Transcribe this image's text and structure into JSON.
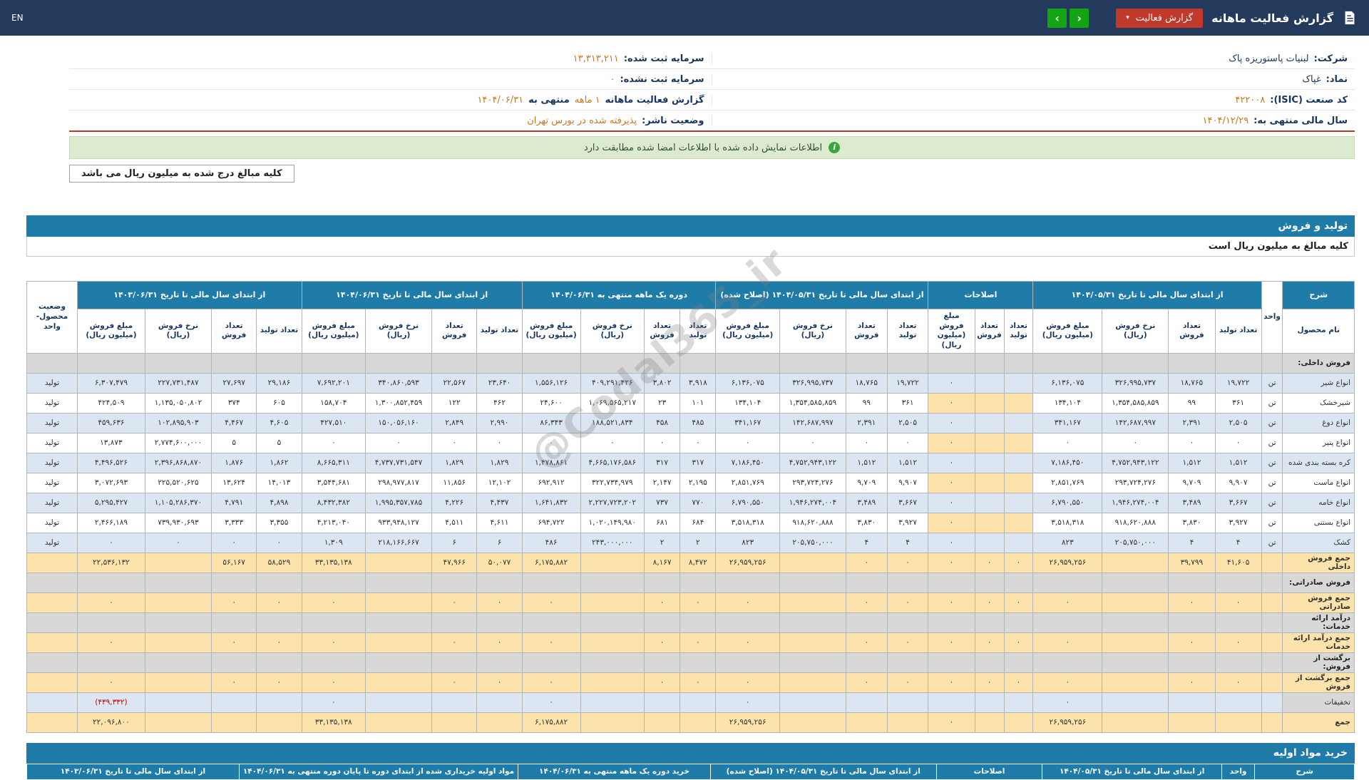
{
  "topbar": {
    "en_label": "EN",
    "title": "گزارش فعالیت ماهانه",
    "report_button_label": "گزارش فعالیت",
    "nav_forward": "›",
    "nav_back": "‹"
  },
  "info": {
    "company_label": "شرکت:",
    "company_value": "لبنیات پاستوریزه پاک",
    "symbol_label": "نماد:",
    "symbol_value": "غپاک",
    "isic_label": "کد صنعت (ISIC):",
    "isic_value": "۴۲۲۰۰۸",
    "fiscal_label": "سال مالی منتهی به:",
    "fiscal_value": "۱۴۰۴/۱۲/۲۹",
    "registered_capital_label": "سرمایه ثبت شده:",
    "registered_capital_value": "۱۳,۳۱۳,۲۱۱",
    "unregistered_capital_label": "سرمایه ثبت نشده:",
    "unregistered_capital_value": "۰",
    "report_period_label": "گزارش فعالیت ماهانه",
    "report_period_value": "۱ ماهه",
    "report_period_suffix": "منتهی به",
    "report_period_date": "۱۴۰۴/۰۶/۳۱",
    "publisher_status_label": "وضعیت ناشر:",
    "publisher_status_value": "پذیرفته شده در بورس تهران"
  },
  "banner": {
    "text": "اطلاعات نمایش داده شده با اطلاعات امضا شده مطابقت دارد",
    "icon": "i"
  },
  "note": {
    "text": "کلیه مبالغ درج شده به میلیون ریال می باشد"
  },
  "production": {
    "bar_title": "تولید و فروش",
    "subtitle": "کلیه مبالغ به میلیون ریال است",
    "table": {
      "headers": {
        "sharh": "شرح",
        "name": "نام محصول",
        "unit": "واحد",
        "status": "وضعیت محصول-واحد"
      },
      "groups": [
        {
          "key": "prior",
          "label": "از ابتدای سال مالی تا تاریخ ۱۴۰۴/۰۵/۳۱",
          "cols": [
            "تعداد تولید",
            "تعداد فروش",
            "نرخ فروش (ریال)",
            "مبلغ فروش (میلیون ریال)"
          ]
        },
        {
          "key": "amend",
          "label": "اصلاحات",
          "cols": [
            "تعداد تولید",
            "تعداد فروش",
            "مبلغ فروش (میلیون ریال)"
          ]
        },
        {
          "key": "amended",
          "label": "از ابتدای سال مالی تا تاریخ ۱۴۰۴/۰۵/۳۱ (اصلاح شده)",
          "cols": [
            "تعداد تولید",
            "تعداد فروش",
            "نرخ فروش (ریال)",
            "مبلغ فروش (میلیون ریال)"
          ]
        },
        {
          "key": "month",
          "label": "دوره یک ماهه منتهی به ۱۴۰۴/۰۶/۳۱",
          "cols": [
            "تعداد تولید",
            "تعداد فروش",
            "نرخ فروش (ریال)",
            "مبلغ فروش (میلیون ریال)"
          ]
        },
        {
          "key": "cur",
          "label": "از ابتدای سال مالی تا تاریخ ۱۴۰۴/۰۶/۳۱",
          "cols": [
            "تعداد تولید",
            "تعداد فروش",
            "نرخ فروش (ریال)",
            "مبلغ فروش (میلیون ریال)"
          ]
        },
        {
          "key": "prev",
          "label": "از ابتدای سال مالی تا تاریخ ۱۴۰۳/۰۶/۳۱",
          "cols": [
            "تعداد تولید",
            "تعداد فروش",
            "نرخ فروش (ریال)",
            "مبلغ فروش (میلیون ریال)"
          ]
        }
      ],
      "rows": [
        {
          "type": "section",
          "name": "فروش داخلی:"
        },
        {
          "type": "data",
          "name": "انواع شیر",
          "unit": "تن",
          "status": "تولید",
          "prior": [
            "۱۹,۷۲۲",
            "۱۸,۷۶۵",
            "۳۲۶,۹۹۵,۷۳۷",
            "۶,۱۳۶,۰۷۵"
          ],
          "amend": [
            "",
            "",
            "۰"
          ],
          "amended": [
            "۱۹,۷۲۲",
            "۱۸,۷۶۵",
            "۳۲۶,۹۹۵,۷۳۷",
            "۶,۱۳۶,۰۷۵"
          ],
          "month": [
            "۳,۹۱۸",
            "۳,۸۰۲",
            "۴۰۹,۲۹۱,۴۲۶",
            "۱,۵۵۶,۱۲۶"
          ],
          "cur": [
            "۲۳,۶۴۰",
            "۲۲,۵۶۷",
            "۳۴۰,۸۶۰,۵۹۳",
            "۷,۶۹۲,۲۰۱"
          ],
          "prev": [
            "۲۹,۱۸۶",
            "۲۷,۶۹۷",
            "۲۲۷,۷۳۱,۴۸۷",
            "۶,۳۰۷,۴۷۹"
          ]
        },
        {
          "type": "data",
          "name": "شیرخشک",
          "unit": "تن",
          "status": "تولید",
          "prior": [
            "۳۶۱",
            "۹۹",
            "۱,۳۵۴,۵۸۵,۸۵۹",
            "۱۳۴,۱۰۴"
          ],
          "amend": [
            "",
            "",
            "۰"
          ],
          "amended": [
            "۳۶۱",
            "۹۹",
            "۱,۳۵۴,۵۸۵,۸۵۹",
            "۱۳۴,۱۰۴"
          ],
          "month": [
            "۱۰۱",
            "۲۳",
            "۱,۰۶۹,۵۶۵,۲۱۷",
            "۲۴,۶۰۰"
          ],
          "cur": [
            "۴۶۲",
            "۱۲۲",
            "۱,۳۰۰,۸۵۲,۴۵۹",
            "۱۵۸,۷۰۴"
          ],
          "prev": [
            "۶۰۵",
            "۳۷۴",
            "۱,۱۳۵,۰۵۰,۸۰۲",
            "۴۲۴,۵۰۹"
          ]
        },
        {
          "type": "data",
          "name": "انواع دوغ",
          "unit": "تن",
          "status": "تولید",
          "prior": [
            "۲,۵۰۵",
            "۲,۳۹۱",
            "۱۴۲,۶۸۷,۹۹۷",
            "۳۴۱,۱۶۷"
          ],
          "amend": [
            "",
            "",
            "۰"
          ],
          "amended": [
            "۲,۵۰۵",
            "۲,۳۹۱",
            "۱۴۲,۶۸۷,۹۹۷",
            "۳۴۱,۱۶۷"
          ],
          "month": [
            "۴۸۵",
            "۴۵۸",
            "۱۸۸,۵۲۱,۸۳۴",
            "۸۶,۳۴۳"
          ],
          "cur": [
            "۲,۹۹۰",
            "۲,۸۴۹",
            "۱۵۰,۰۵۶,۱۶۰",
            "۴۲۷,۵۱۰"
          ],
          "prev": [
            "۴,۶۰۵",
            "۴,۴۶۷",
            "۱۰۲,۸۹۵,۹۰۳",
            "۴۵۹,۶۳۶"
          ]
        },
        {
          "type": "data",
          "name": "انواع پنیر",
          "unit": "تن",
          "status": "تولید",
          "prior": [
            "۰",
            "۰",
            "۰",
            "۰"
          ],
          "amend": [
            "",
            "",
            "۰"
          ],
          "amended": [
            "۰",
            "۰",
            "۰",
            "۰"
          ],
          "month": [
            "۰",
            "۰",
            "۰",
            "۰"
          ],
          "cur": [
            "۰",
            "۰",
            "۰",
            "۰"
          ],
          "prev": [
            "۵",
            "۵",
            "۲,۷۷۴,۶۰۰,۰۰۰",
            "۱۳,۸۷۳"
          ]
        },
        {
          "type": "data",
          "name": "کره بسته بندی شده",
          "unit": "تن",
          "status": "تولید",
          "prior": [
            "۱,۵۱۲",
            "۱,۵۱۲",
            "۴,۷۵۲,۹۴۳,۱۲۲",
            "۷,۱۸۶,۴۵۰"
          ],
          "amend": [
            "",
            "",
            "۰"
          ],
          "amended": [
            "۱,۵۱۲",
            "۱,۵۱۲",
            "۴,۷۵۲,۹۴۳,۱۲۲",
            "۷,۱۸۶,۴۵۰"
          ],
          "month": [
            "۳۱۷",
            "۳۱۷",
            "۴,۶۶۵,۱۷۶,۵۸۶",
            "۱,۴۷۸,۸۶۱"
          ],
          "cur": [
            "۱,۸۲۹",
            "۱,۸۲۹",
            "۴,۷۳۷,۷۳۱,۵۴۷",
            "۸,۶۶۵,۳۱۱"
          ],
          "prev": [
            "۱,۸۶۲",
            "۱,۸۷۶",
            "۲,۳۹۶,۸۶۸,۸۷۰",
            "۴,۴۹۶,۵۲۶"
          ]
        },
        {
          "type": "data",
          "name": "انواع ماست",
          "unit": "تن",
          "status": "تولید",
          "prior": [
            "۹,۹۰۷",
            "۹,۷۰۹",
            "۲۹۳,۷۲۴,۲۷۶",
            "۲,۸۵۱,۷۶۹"
          ],
          "amend": [
            "",
            "",
            "۰"
          ],
          "amended": [
            "۹,۹۰۷",
            "۹,۷۰۹",
            "۲۹۳,۷۲۴,۲۷۶",
            "۲,۸۵۱,۷۶۹"
          ],
          "month": [
            "۲,۱۹۵",
            "۲,۱۴۷",
            "۳۲۲,۷۳۴,۹۷۹",
            "۶۹۲,۹۱۲"
          ],
          "cur": [
            "۱۲,۱۰۲",
            "۱۱,۸۵۶",
            "۲۹۸,۹۷۷,۸۱۷",
            "۳,۵۴۴,۶۸۱"
          ],
          "prev": [
            "۱۴,۰۱۳",
            "۱۳,۶۲۴",
            "۲۲۵,۵۲۰,۶۲۵",
            "۳,۰۷۲,۶۹۳"
          ]
        },
        {
          "type": "data",
          "name": "انواع خامه",
          "unit": "تن",
          "status": "تولید",
          "prior": [
            "۳,۶۶۷",
            "۳,۴۸۹",
            "۱,۹۴۶,۲۷۴,۰۰۴",
            "۶,۷۹۰,۵۵۰"
          ],
          "amend": [
            "",
            "",
            "۰"
          ],
          "amended": [
            "۳,۶۶۷",
            "۳,۴۸۹",
            "۱,۹۴۶,۲۷۴,۰۰۴",
            "۶,۷۹۰,۵۵۰"
          ],
          "month": [
            "۷۷۰",
            "۷۳۷",
            "۲,۲۲۷,۷۲۳,۲۰۲",
            "۱,۶۴۱,۸۳۲"
          ],
          "cur": [
            "۴,۴۳۷",
            "۴,۲۲۶",
            "۱,۹۹۵,۳۵۷,۷۸۵",
            "۸,۴۳۲,۳۸۲"
          ],
          "prev": [
            "۴,۸۹۸",
            "۴,۷۹۱",
            "۱,۱۰۵,۲۸۶,۳۷۰",
            "۵,۲۹۵,۴۲۷"
          ]
        },
        {
          "type": "data",
          "name": "انواع بستنی",
          "unit": "تن",
          "status": "تولید",
          "prior": [
            "۳,۹۲۷",
            "۳,۸۳۰",
            "۹۱۸,۶۲۰,۸۸۸",
            "۳,۵۱۸,۳۱۸"
          ],
          "amend": [
            "",
            "",
            "۰"
          ],
          "amended": [
            "۳,۹۲۷",
            "۳,۸۳۰",
            "۹۱۸,۶۲۰,۸۸۸",
            "۳,۵۱۸,۳۱۸"
          ],
          "month": [
            "۶۸۴",
            "۶۸۱",
            "۱,۰۲۰,۱۴۹,۹۸۰",
            "۶۹۴,۷۲۲"
          ],
          "cur": [
            "۴,۶۱۱",
            "۴,۵۱۱",
            "۹۳۳,۹۴۸,۱۲۷",
            "۴,۲۱۳,۰۴۰"
          ],
          "prev": [
            "۳,۳۵۵",
            "۳,۳۳۳",
            "۷۳۹,۹۳۰,۶۹۳",
            "۲,۴۶۶,۱۸۹"
          ]
        },
        {
          "type": "data",
          "name": "کشک",
          "unit": "تن",
          "status": "تولید",
          "prior": [
            "۴",
            "۴",
            "۲۰۵,۷۵۰,۰۰۰",
            "۸۲۳"
          ],
          "amend": [
            "",
            "",
            "۰"
          ],
          "amended": [
            "۴",
            "۴",
            "۲۰۵,۷۵۰,۰۰۰",
            "۸۲۳"
          ],
          "month": [
            "۲",
            "۲",
            "۲۴۳,۰۰۰,۰۰۰",
            "۴۸۶"
          ],
          "cur": [
            "۶",
            "۶",
            "۲۱۸,۱۶۶,۶۶۷",
            "۱,۳۰۹"
          ],
          "prev": [
            "۰",
            "۰",
            "۰",
            "۰"
          ]
        },
        {
          "type": "total",
          "name": "جمع فروش داخلی",
          "unit": "",
          "status": "",
          "prior": [
            "۴۱,۶۰۵",
            "۳۹,۷۹۹",
            "",
            "۲۶,۹۵۹,۲۵۶"
          ],
          "amend": [
            "۰",
            "۰",
            "۰"
          ],
          "amended": [
            "۰",
            "۰",
            "",
            "۲۶,۹۵۹,۲۵۶"
          ],
          "month": [
            "۸,۴۷۲",
            "۸,۱۶۷",
            "",
            "۶,۱۷۵,۸۸۲"
          ],
          "cur": [
            "۵۰,۰۷۷",
            "۴۷,۹۶۶",
            "",
            "۳۳,۱۳۵,۱۳۸"
          ],
          "prev": [
            "۵۸,۵۲۹",
            "۵۶,۱۶۷",
            "",
            "۲۲,۵۳۶,۱۳۲"
          ]
        },
        {
          "type": "section",
          "name": "فروش صادراتی:"
        },
        {
          "type": "total",
          "name": "جمع فروش صادراتی",
          "unit": "",
          "status": "",
          "prior": [
            "۰",
            "۰",
            "",
            "۰"
          ],
          "amend": [
            "۰",
            "۰",
            "۰"
          ],
          "amended": [
            "۰",
            "۰",
            "",
            "۰"
          ],
          "month": [
            "۰",
            "۰",
            "",
            "۰"
          ],
          "cur": [
            "۰",
            "۰",
            "",
            "۰"
          ],
          "prev": [
            "۰",
            "۰",
            "",
            "۰"
          ]
        },
        {
          "type": "section",
          "name": "درآمد ارائه خدمات:"
        },
        {
          "type": "total",
          "name": "جمع درآمد ارائه خدمات",
          "unit": "",
          "status": "",
          "prior": [
            "۰",
            "۰",
            "",
            "۰"
          ],
          "amend": [
            "۰",
            "۰",
            "۰"
          ],
          "amended": [
            "۰",
            "۰",
            "",
            "۰"
          ],
          "month": [
            "۰",
            "۰",
            "",
            "۰"
          ],
          "cur": [
            "۰",
            "۰",
            "",
            "۰"
          ],
          "prev": [
            "۰",
            "۰",
            "",
            "۰"
          ]
        },
        {
          "type": "section",
          "name": "برگشت از فروش:"
        },
        {
          "type": "total",
          "name": "جمع برگشت از فروش",
          "unit": "",
          "status": "",
          "prior": [
            "۰",
            "۰",
            "",
            "۰"
          ],
          "amend": [
            "۰",
            "۰",
            "۰"
          ],
          "amended": [
            "۰",
            "۰",
            "",
            "۰"
          ],
          "month": [
            "۰",
            "۰",
            "",
            "۰"
          ],
          "cur": [
            "۰",
            "۰",
            "",
            "۰"
          ],
          "prev": [
            "۰",
            "۰",
            "",
            "۰"
          ]
        },
        {
          "type": "discount",
          "name": "تخفیفات",
          "unit": "",
          "status": "",
          "prior": [
            "",
            "",
            "",
            "۰"
          ],
          "amend": [
            "",
            "",
            ""
          ],
          "amended": [
            "",
            "",
            "",
            "۰"
          ],
          "month": [
            "",
            "",
            "",
            "۰"
          ],
          "cur": [
            "",
            "",
            "",
            "۰"
          ],
          "prev": [
            "",
            "",
            "",
            "(۴۳۹,۳۳۲)"
          ]
        },
        {
          "type": "total",
          "name": "جمع",
          "unit": "",
          "status": "",
          "prior": [
            "",
            "",
            "",
            "۲۶,۹۵۹,۲۵۶"
          ],
          "amend": [
            "",
            "",
            "۰"
          ],
          "amended": [
            "",
            "",
            "",
            "۲۶,۹۵۹,۲۵۶"
          ],
          "month": [
            "",
            "",
            "",
            "۶,۱۷۵,۸۸۲"
          ],
          "cur": [
            "",
            "",
            "",
            "۳۳,۱۳۵,۱۳۸"
          ],
          "prev": [
            "",
            "",
            "",
            "۲۲,۰۹۶,۸۰۰"
          ]
        }
      ]
    }
  },
  "purchase": {
    "bar_title": "خرید مواد اولیه",
    "headers": [
      "شرح",
      "واحد",
      "از ابتدای سال مالی تا تاریخ ۱۴۰۴/۰۵/۳۱",
      "اصلاحات",
      "از ابتدای سال مالی تا تاریخ ۱۴۰۴/۰۵/۳۱ (اصلاح شده)",
      "خرید دوره یک ماهه منتهی به ۱۴۰۴/۰۶/۳۱",
      "مواد اولیه خریداری شده از ابتدای دوره تا پایان دوره منتهی به ۱۴۰۴/۰۶/۳۱",
      "از ابتدای سال مالی تا تاریخ ۱۴۰۳/۰۶/۳۱"
    ]
  },
  "watermark": {
    "text": "@Codal365_ir"
  },
  "colors": {
    "topbar_navy": "#243a5c",
    "accent_blue": "#1f7ca8",
    "button_red": "#c0392b",
    "button_green": "#12a412",
    "highlight_yellow": "#fce3ac",
    "alt_row_blue": "#dbe6f2",
    "section_gray": "#d8d8d8",
    "value_orange": "#c87820",
    "negative_red": "#c00000"
  }
}
